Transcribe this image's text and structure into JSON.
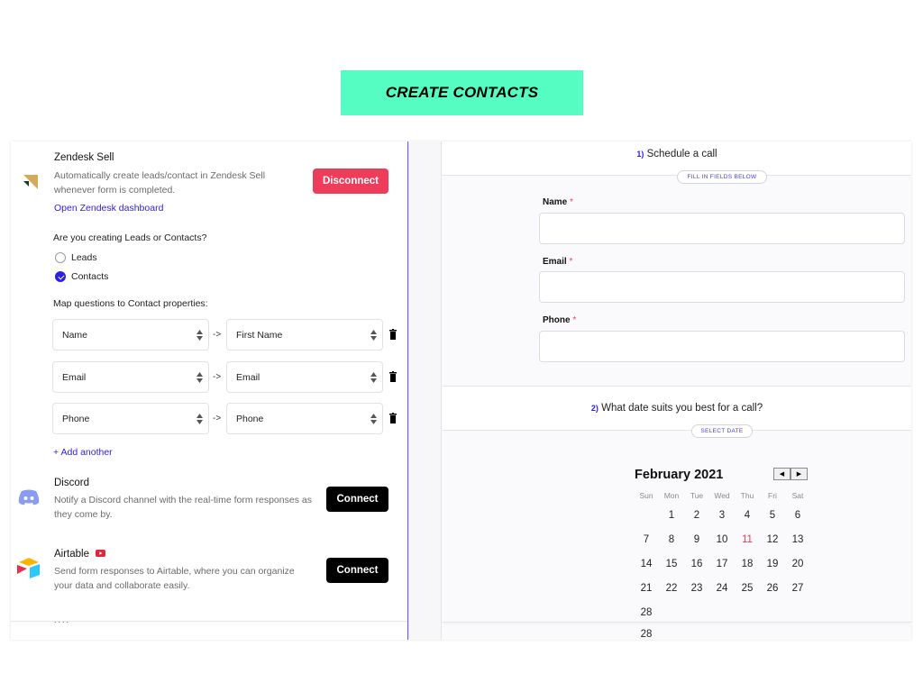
{
  "banner": {
    "title": "CREATE CONTACTS",
    "color": "#55fdc2"
  },
  "left": {
    "zendesk": {
      "name": "Zendesk Sell",
      "description_line1": "Automatically create leads/contact in Zendesk Sell",
      "description_line2": "whenever form is completed.",
      "link": "Open Zendesk dashboard",
      "button": "Disconnect",
      "icon": "zendesk-logo"
    },
    "type_question": "Are you creating Leads or Contacts?",
    "options": [
      {
        "label": "Leads",
        "checked": false
      },
      {
        "label": "Contacts",
        "checked": true
      }
    ],
    "map_label": "Map questions to Contact properties:",
    "mappings": [
      {
        "question": "Name",
        "arrow": "->",
        "property": "First Name"
      },
      {
        "question": "Email",
        "arrow": "->",
        "property": "Email"
      },
      {
        "question": "Phone",
        "arrow": "->",
        "property": "Phone"
      }
    ],
    "add_another": "+ Add another",
    "discord": {
      "name": "Discord",
      "description_line1": "Notify a Discord channel with the real-time form responses as",
      "description_line2": "they come by.",
      "button": "Connect",
      "icon": "discord-logo"
    },
    "airtable": {
      "name": "Airtable",
      "description_line1": "Send form responses to Airtable, where you can organize",
      "description_line2": "your data and collaborate easily.",
      "button": "Connect",
      "icon": "airtable-logo",
      "badge_icon": "youtube-icon"
    },
    "truncated_text": "...."
  },
  "right": {
    "q1": {
      "number": "1)",
      "title": "Schedule a call",
      "pill": "FILL IN FIELDS BELOW"
    },
    "fields": [
      {
        "label": "Name",
        "required": "*",
        "value": ""
      },
      {
        "label": "Email",
        "required": "*",
        "value": ""
      },
      {
        "label": "Phone",
        "required": "*",
        "value": ""
      }
    ],
    "q2": {
      "number": "2)",
      "title": "What date suits you best for a call?",
      "pill": "SELECT DATE"
    },
    "calendar": {
      "month": "February 2021",
      "prev": "◀",
      "next": "▶",
      "weekdays": [
        "Sun",
        "Mon",
        "Tue",
        "Wed",
        "Thu",
        "Fri",
        "Sat"
      ],
      "weeks": [
        [
          "",
          "1",
          "2",
          "3",
          "4",
          "5",
          "6"
        ],
        [
          "7",
          "8",
          "9",
          "10",
          "11",
          "12",
          "13"
        ],
        [
          "14",
          "15",
          "16",
          "17",
          "18",
          "19",
          "20"
        ],
        [
          "21",
          "22",
          "23",
          "24",
          "25",
          "26",
          "27"
        ],
        [
          "28",
          "",
          "",
          "",
          "",
          "",
          ""
        ]
      ],
      "today": "11",
      "overflow_day": "28"
    }
  }
}
